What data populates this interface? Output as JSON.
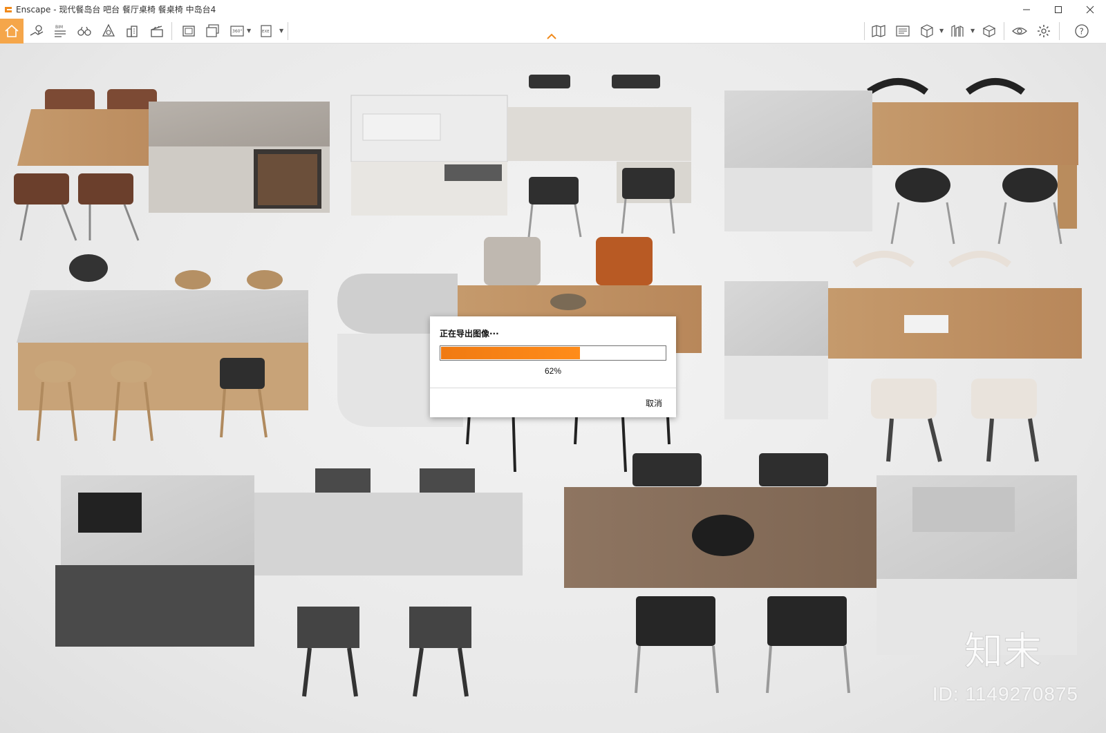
{
  "window": {
    "title": "Enscape - 现代餐岛台 吧台 餐厅桌椅 餐桌椅 中岛台4",
    "controls": [
      "minimize",
      "maximize",
      "close"
    ]
  },
  "toolbar": {
    "left_icons": [
      "home-icon",
      "location-pin-icon",
      "bim-icon",
      "binoculars-icon",
      "atmosphere-icon",
      "buildings-icon",
      "clapperboard-icon",
      "screenshot-icon",
      "batch-render-icon",
      "panorama-360-icon",
      "export-exe-icon"
    ],
    "right_icons": [
      "map-icon",
      "visual-settings-icon",
      "cube-icon",
      "asset-library-icon",
      "material-editor-icon",
      "view-toggle-icon",
      "settings-icon",
      "help-icon"
    ],
    "bim_label": "BIM",
    "pano_label": "360°",
    "exe_label": "EXE"
  },
  "export_dialog": {
    "title": "正在导出图像···",
    "progress": 0.62,
    "progress_label": "62%",
    "cancel_label": "取消"
  },
  "watermark": {
    "logo_text": "知末",
    "id_text": "ID: 1149270875"
  },
  "colors": {
    "accent": "#f5a64a",
    "progress": "#f07a12"
  }
}
